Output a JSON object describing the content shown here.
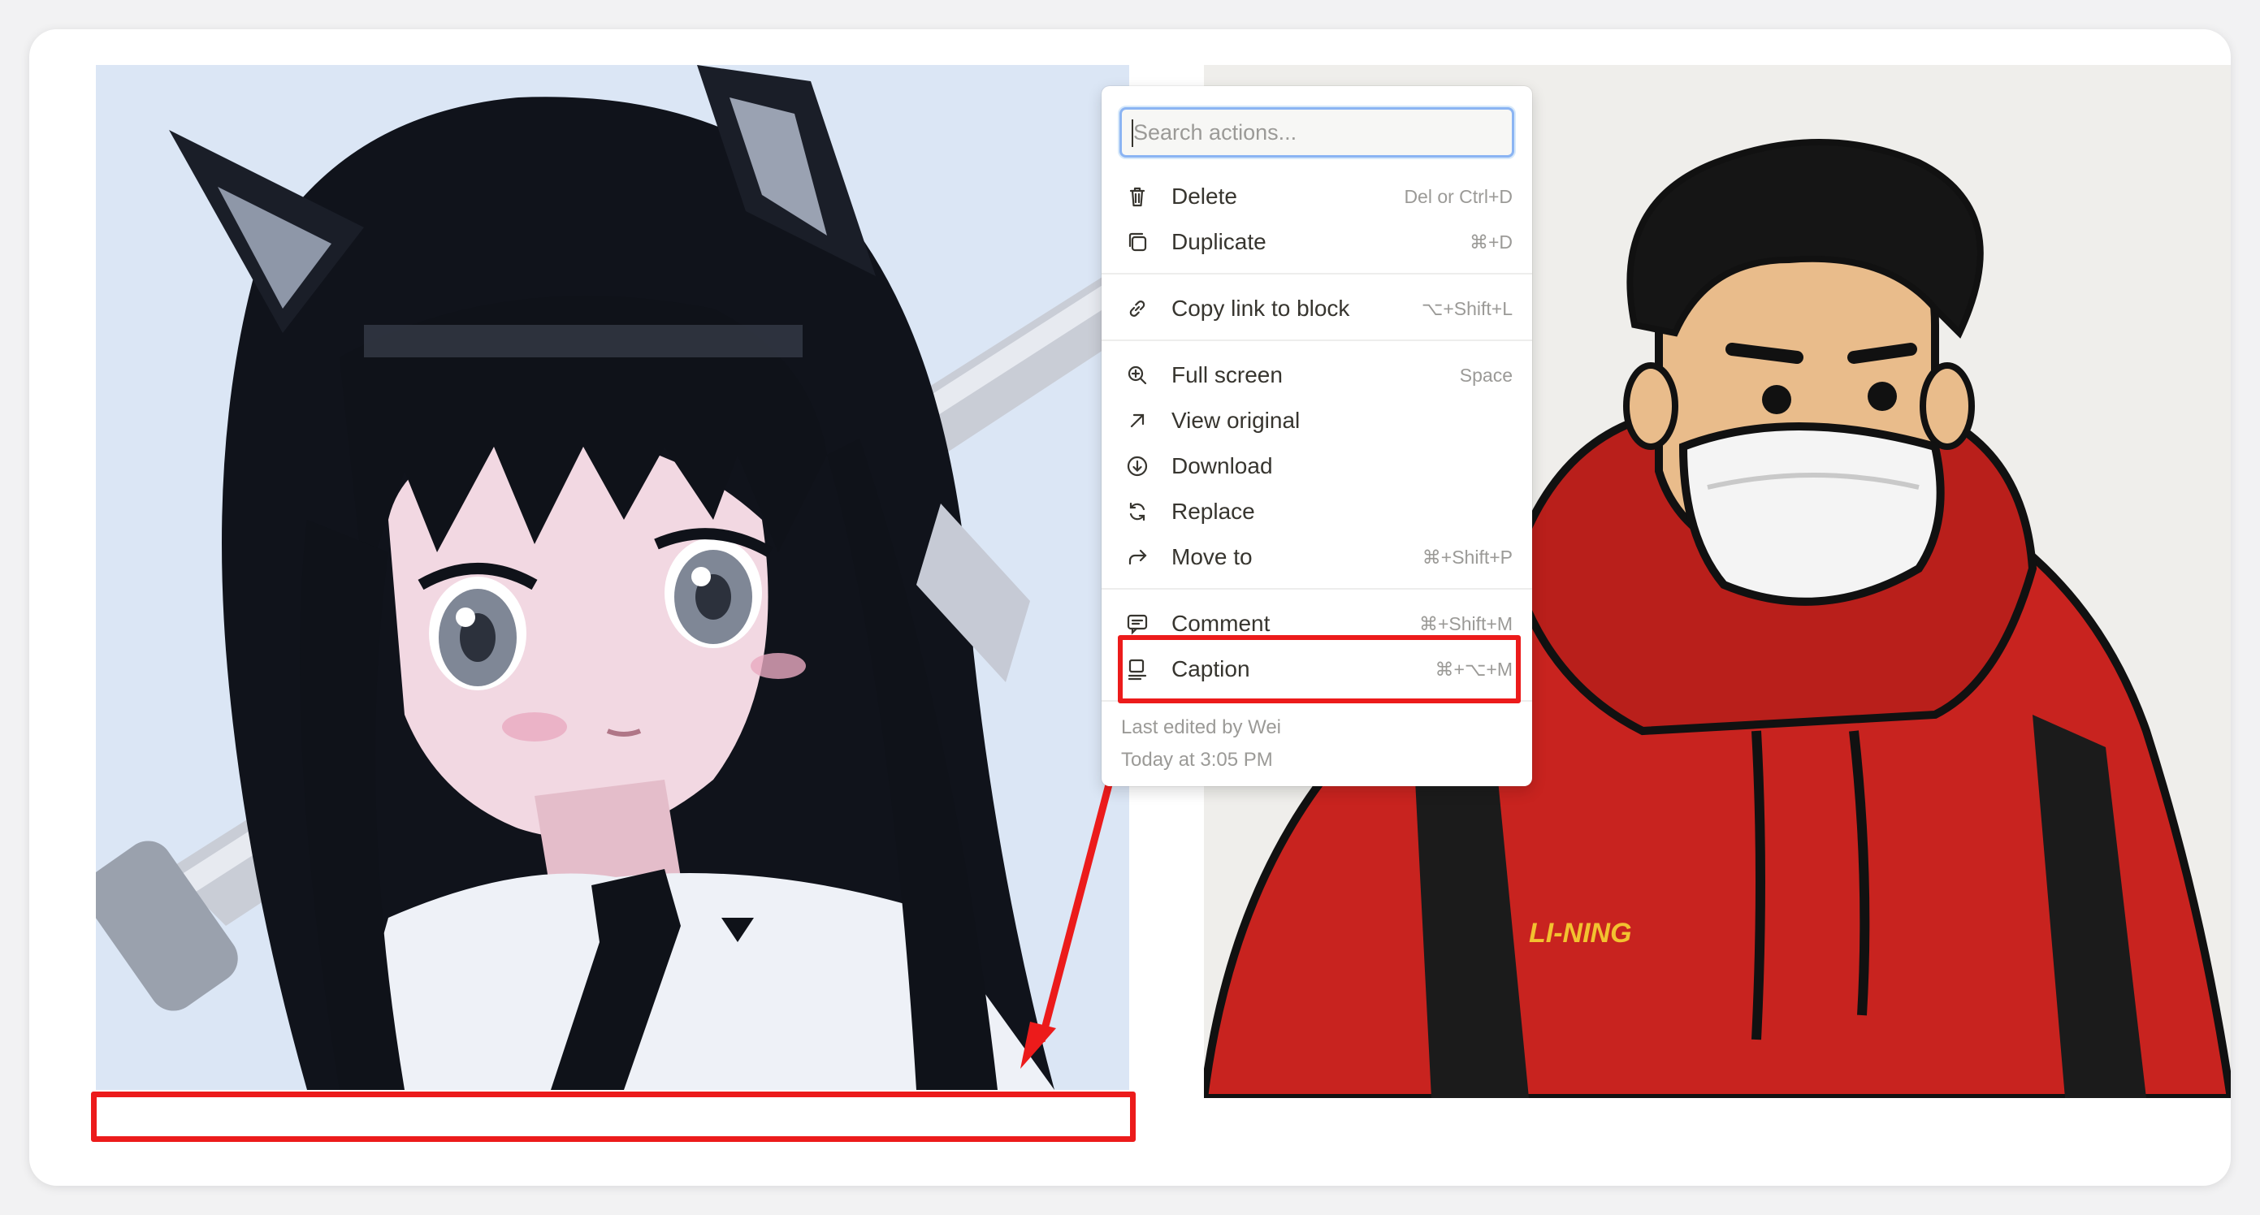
{
  "menu": {
    "search_placeholder": "Search actions...",
    "groups": [
      [
        {
          "icon": "trash-icon",
          "label": "Delete",
          "shortcut": "Del or Ctrl+D"
        },
        {
          "icon": "duplicate-icon",
          "label": "Duplicate",
          "shortcut": "⌘+D"
        }
      ],
      [
        {
          "icon": "link-icon",
          "label": "Copy link to block",
          "shortcut": "⌥+Shift+L"
        }
      ],
      [
        {
          "icon": "zoom-in-icon",
          "label": "Full screen",
          "shortcut": "Space"
        },
        {
          "icon": "arrow-up-right-icon",
          "label": "View original",
          "shortcut": ""
        },
        {
          "icon": "download-icon",
          "label": "Download",
          "shortcut": ""
        },
        {
          "icon": "refresh-icon",
          "label": "Replace",
          "shortcut": ""
        },
        {
          "icon": "move-arrow-icon",
          "label": "Move to",
          "shortcut": "⌘+Shift+P"
        }
      ],
      [
        {
          "icon": "comment-icon",
          "label": "Comment",
          "shortcut": "⌘+Shift+M"
        },
        {
          "icon": "caption-icon",
          "label": "Caption",
          "shortcut": "⌘+⌥+M"
        }
      ]
    ],
    "last_edited": "Last edited by Wei",
    "edited_time": "Today at 3:05 PM"
  },
  "images": {
    "right_logo_text": "LI-NING"
  },
  "colors": {
    "annotation_red": "#ec1b1b",
    "search_focus": "#8bb4f3",
    "hoodie_red": "#c8231f"
  }
}
